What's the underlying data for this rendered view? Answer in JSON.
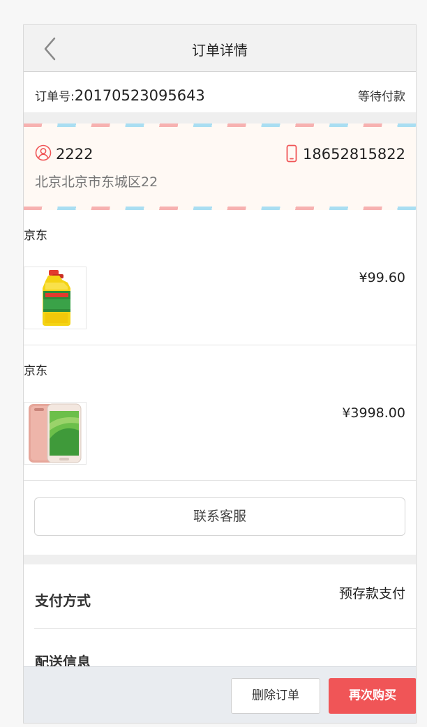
{
  "header": {
    "title": "订单详情",
    "back_icon": "chevron-left-icon"
  },
  "order": {
    "number_label": "订单号:",
    "number": "20170523095643",
    "status": "等待付款"
  },
  "address": {
    "name": "2222",
    "phone": "18652815822",
    "address": "北京北京市东城区22",
    "user_icon": "user-icon",
    "phone_icon": "mobile-phone-icon",
    "icon_color": "#f05557"
  },
  "shops": [
    {
      "name": "京东",
      "product": {
        "image": "oil-bottle-image",
        "price": "¥99.60"
      }
    },
    {
      "name": "京东",
      "product": {
        "image": "smartphone-image",
        "price": "¥3998.00"
      }
    }
  ],
  "contact_button": "联系客服",
  "payment": {
    "label": "支付方式",
    "value": "预存款支付"
  },
  "delivery": {
    "label": "配送信息"
  },
  "actions": {
    "delete_label": "删除订单",
    "rebuy_label": "再次购买",
    "rebuy_color": "#f05557"
  }
}
